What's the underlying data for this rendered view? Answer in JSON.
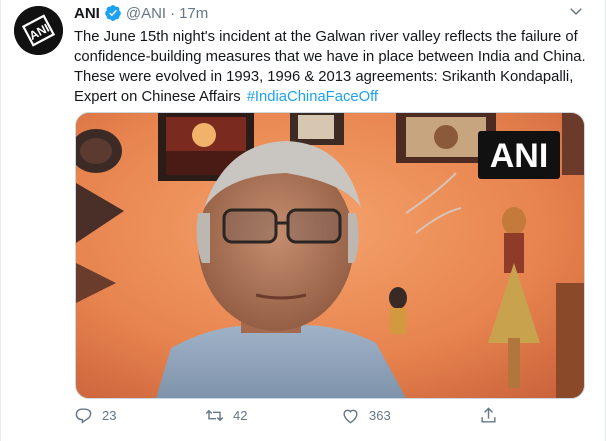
{
  "tweet": {
    "author_name": "ANI",
    "author_handle": "@ANI",
    "separator": "·",
    "time": "17m",
    "avatar_logo": "ANI",
    "text_body": "The June 15th night's incident at the Galwan river valley reflects the failure of confidence-building measures that we have in place between India and China. These were evolved in 1993, 1996 & 2013 agreements: Srikanth Kondapalli, Expert on Chinese Affairs",
    "hashtag": "#IndiaChinaFaceOff",
    "media_watermark": "ANI"
  },
  "actions": {
    "reply_count": "23",
    "retweet_count": "42",
    "like_count": "363"
  },
  "colors": {
    "link": "#1da1f2",
    "secondary_text": "#657786",
    "verified": "#1da1f2"
  },
  "icons": [
    "verified-badge-icon",
    "chevron-down-icon",
    "reply-icon",
    "retweet-icon",
    "like-icon",
    "share-icon"
  ]
}
